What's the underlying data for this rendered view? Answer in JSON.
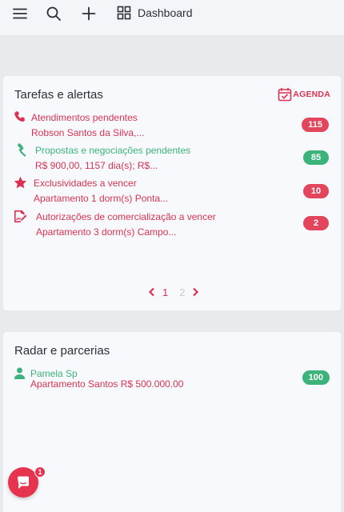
{
  "topbar": {
    "menu_icon": "menu-icon",
    "search_icon": "search-icon",
    "add_icon": "plus-icon",
    "dashboard_icon": "grid-icon",
    "dashboard_label": "Dashboard"
  },
  "tasks_card": {
    "title": "Tarefas e alertas",
    "agenda_label": "AGENDA",
    "items": [
      {
        "icon": "phone-icon",
        "label": "Atendimentos pendentes",
        "sub": "Robson Santos da Silva,...",
        "count": "115",
        "color": "#d93350"
      },
      {
        "icon": "gavel-icon",
        "label": "Propostas e negociações pendentes",
        "sub": "R$ 900,00, 1157 dia(s); R$...",
        "count": "85",
        "color": "#3cb37a"
      },
      {
        "icon": "star-icon",
        "label": "Exclusividades a vencer",
        "sub": "Apartamento 1 dorm(s) Ponta...",
        "count": "10",
        "color": "#d93350"
      },
      {
        "icon": "signature-icon",
        "label": "Autorizações de comercialização a vencer",
        "sub": "Apartamento 3 dorm(s) Campo...",
        "count": "2",
        "color": "#d93350"
      }
    ],
    "pager": {
      "current": "1",
      "next": "2"
    }
  },
  "radar_card": {
    "title": "Radar e parcerias",
    "item": {
      "icon": "user-icon",
      "name": "Pamela Sp",
      "sub": "Apartamento Santos R$ 500.000.00",
      "count": "100",
      "color": "#3cb37a"
    }
  },
  "chat": {
    "icon": "chat-icon",
    "badge": "1",
    "color": "#e6344f"
  }
}
